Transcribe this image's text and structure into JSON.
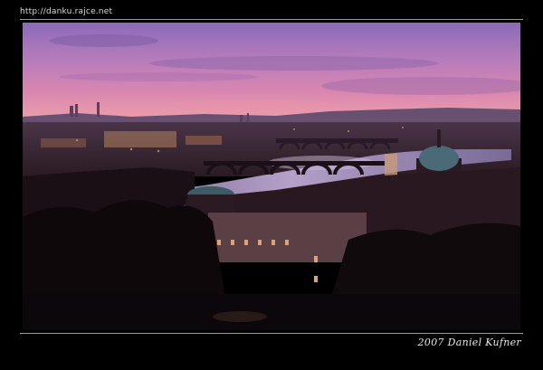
{
  "header": {
    "url": "http://danku.rajce.net"
  },
  "footer": {
    "credit": "2007 Daniel Kufner"
  },
  "photo": {
    "subject": "city-river-bridges-dusk",
    "colors": {
      "sky_top": "#7a6ab0",
      "sky_mid": "#b77db8",
      "sky_glow": "#e08aa8",
      "horizon": "#f0a0a8",
      "city": "#3a2a3a",
      "river": "#8a7aa8",
      "foreground": "#140c10"
    }
  }
}
